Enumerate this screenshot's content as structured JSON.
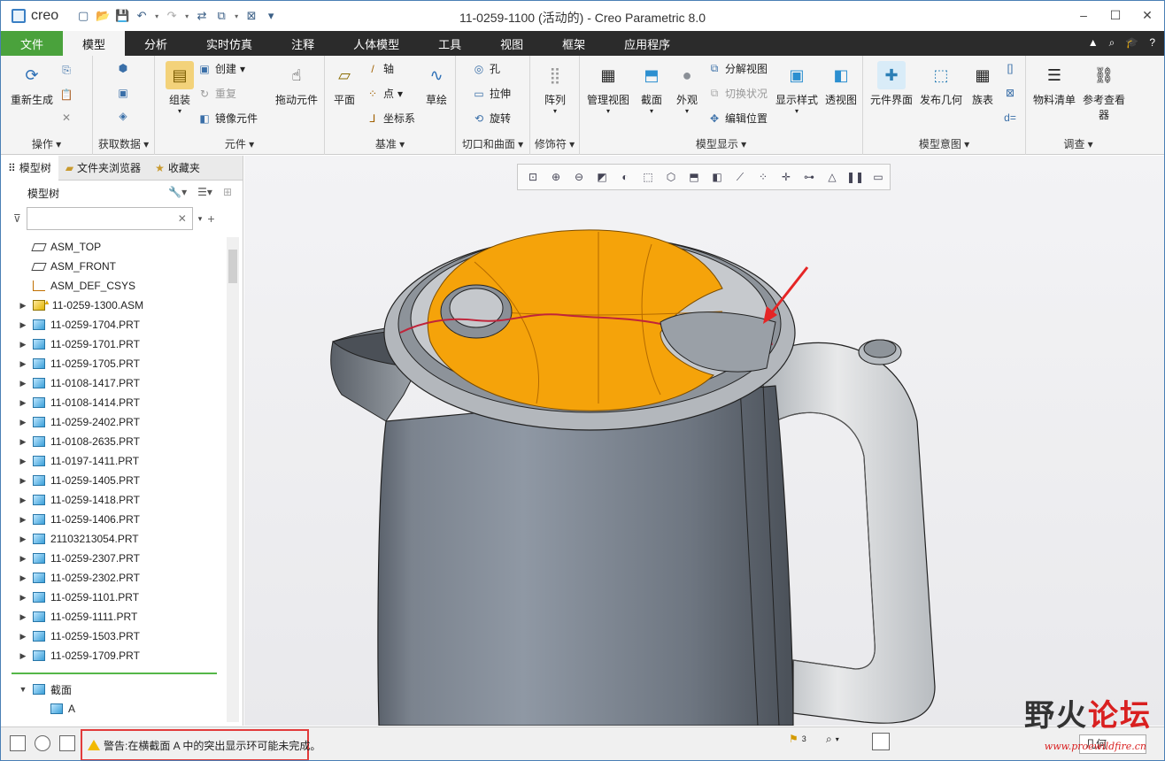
{
  "window": {
    "title": "11-0259-1100 (活动的) - Creo Parametric 8.0",
    "app_logo": "creo"
  },
  "menu_tabs": [
    "文件",
    "模型",
    "分析",
    "实时仿真",
    "注释",
    "人体模型",
    "工具",
    "视图",
    "框架",
    "应用程序"
  ],
  "ribbon": {
    "operations": {
      "label": "操作",
      "regenerate": "重新生成"
    },
    "get_data": {
      "label": "获取数据"
    },
    "component": {
      "label": "元件",
      "assemble": "组装",
      "create": "创建",
      "repeat": "重复",
      "mirror": "镜像元件",
      "drag": "拖动元件"
    },
    "datum": {
      "label": "基准",
      "plane": "平面",
      "axis": "轴",
      "point": "点",
      "csys": "坐标系",
      "sketch": "草绘"
    },
    "cut_surface": {
      "label": "切口和曲面",
      "hole": "孔",
      "extrude": "拉伸",
      "revolve": "旋转"
    },
    "modifiers": {
      "label": "修饰符",
      "pattern": "阵列"
    },
    "model_display": {
      "label": "模型显示",
      "manage_views": "管理视图",
      "section": "截面",
      "appearance": "外观",
      "exploded_view": "分解视图",
      "toggle_status": "切换状况",
      "edit_position": "编辑位置",
      "display_style": "显示样式",
      "perspective": "透视图"
    },
    "model_intent": {
      "label": "模型意图",
      "component_interface": "元件界面",
      "publish_geometry": "发布几何",
      "family_table": "族表",
      "d_equals": "d="
    },
    "investigate": {
      "label": "调查",
      "bom": "物料清单",
      "reference_viewer": "参考查看器"
    }
  },
  "left_panel": {
    "tabs": [
      "模型树",
      "文件夹浏览器",
      "收藏夹"
    ],
    "header": "模型树",
    "filter_placeholder": "",
    "tree": [
      {
        "name": "ASM_TOP",
        "type": "plane"
      },
      {
        "name": "ASM_FRONT",
        "type": "plane"
      },
      {
        "name": "ASM_DEF_CSYS",
        "type": "csys"
      },
      {
        "name": "11-0259-1300.ASM",
        "type": "asm",
        "warn": true
      },
      {
        "name": "11-0259-1704.PRT",
        "type": "part"
      },
      {
        "name": "11-0259-1701.PRT",
        "type": "part"
      },
      {
        "name": "11-0259-1705.PRT",
        "type": "part"
      },
      {
        "name": "11-0108-1417.PRT",
        "type": "part"
      },
      {
        "name": "11-0108-1414.PRT",
        "type": "part"
      },
      {
        "name": "11-0259-2402.PRT",
        "type": "part"
      },
      {
        "name": "11-0108-2635.PRT",
        "type": "part"
      },
      {
        "name": "11-0197-1411.PRT",
        "type": "part"
      },
      {
        "name": "11-0259-1405.PRT",
        "type": "part"
      },
      {
        "name": "11-0259-1418.PRT",
        "type": "part"
      },
      {
        "name": "11-0259-1406.PRT",
        "type": "part"
      },
      {
        "name": "21103213054.PRT",
        "type": "part"
      },
      {
        "name": "11-0259-2307.PRT",
        "type": "part"
      },
      {
        "name": "11-0259-2302.PRT",
        "type": "part"
      },
      {
        "name": "11-0259-1101.PRT",
        "type": "part"
      },
      {
        "name": "11-0259-1111.PRT",
        "type": "part"
      },
      {
        "name": "11-0259-1503.PRT",
        "type": "part"
      },
      {
        "name": "11-0259-1709.PRT",
        "type": "part"
      }
    ],
    "sections": {
      "label": "截面",
      "items": [
        "A"
      ]
    }
  },
  "status": {
    "message": "警告:在横截面 A 中的突出显示环可能未完成。",
    "flag_count": "3",
    "selection_filter": "几何"
  },
  "watermark": {
    "text_black": "野火",
    "text_red": "论坛",
    "url": "www.proewildfire.cn"
  },
  "colors": {
    "file_tab": "#4aa23c",
    "lid_orange": "#f5a30a",
    "highlight_red": "#c0243a",
    "annotation_arrow": "#e52525",
    "status_box": "#e23b3b"
  }
}
